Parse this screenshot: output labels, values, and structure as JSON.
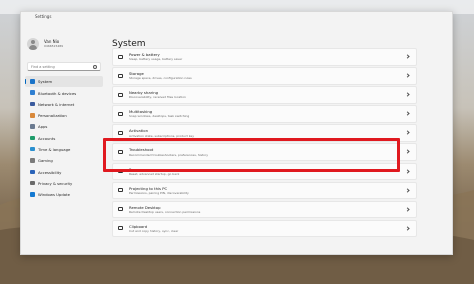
{
  "window": {
    "app_title": "Settings"
  },
  "profile": {
    "name": "Van Nio",
    "email": "0466515489"
  },
  "search": {
    "placeholder": "Find a setting"
  },
  "sidebar": {
    "items": [
      {
        "label": "System",
        "icon": "monitor-icon",
        "color": "#1a73c8",
        "active": true
      },
      {
        "label": "Bluetooth & devices",
        "icon": "bluetooth-icon",
        "color": "#2f7fd1"
      },
      {
        "label": "Network & internet",
        "icon": "wifi-icon",
        "color": "#3b5b9e"
      },
      {
        "label": "Personalization",
        "icon": "brush-icon",
        "color": "#d8883a"
      },
      {
        "label": "Apps",
        "icon": "apps-icon",
        "color": "#6b7a90"
      },
      {
        "label": "Accounts",
        "icon": "person-icon",
        "color": "#1e9c6a"
      },
      {
        "label": "Time & language",
        "icon": "globe-clock-icon",
        "color": "#2a8fcf"
      },
      {
        "label": "Gaming",
        "icon": "controller-icon",
        "color": "#7a7a7a"
      },
      {
        "label": "Accessibility",
        "icon": "accessibility-icon",
        "color": "#2a63b8"
      },
      {
        "label": "Privacy & security",
        "icon": "shield-icon",
        "color": "#6a6a6a"
      },
      {
        "label": "Windows Update",
        "icon": "update-icon",
        "color": "#1479d1"
      }
    ]
  },
  "main": {
    "title": "System",
    "cards": [
      {
        "title": "Power & battery",
        "subtitle": "Sleep, battery usage, battery saver",
        "icon": "power-icon"
      },
      {
        "title": "Storage",
        "subtitle": "Storage space, drives, configuration rules",
        "icon": "drive-icon"
      },
      {
        "title": "Nearby sharing",
        "subtitle": "Discoverability, received files location",
        "icon": "share-icon"
      },
      {
        "title": "Multitasking",
        "subtitle": "Snap windows, desktops, task switching",
        "icon": "multitask-icon"
      },
      {
        "title": "Activation",
        "subtitle": "Activation state, subscriptions, product key",
        "icon": "key-icon"
      },
      {
        "title": "Troubleshoot",
        "subtitle": "Recommended troubleshooters, preferences, history",
        "icon": "wrench-icon"
      },
      {
        "title": "Recovery",
        "subtitle": "Reset, advanced startup, go back",
        "icon": "recovery-icon"
      },
      {
        "title": "Projecting to this PC",
        "subtitle": "Permissions, pairing PIN, discoverability",
        "icon": "project-icon"
      },
      {
        "title": "Remote Desktop",
        "subtitle": "Remote Desktop users, connection permissions",
        "icon": "remote-icon"
      },
      {
        "title": "Clipboard",
        "subtitle": "Cut and copy history, sync, clear",
        "icon": "clipboard-icon"
      }
    ]
  },
  "highlight": {
    "target": "Troubleshoot",
    "color": "#e0191f"
  }
}
